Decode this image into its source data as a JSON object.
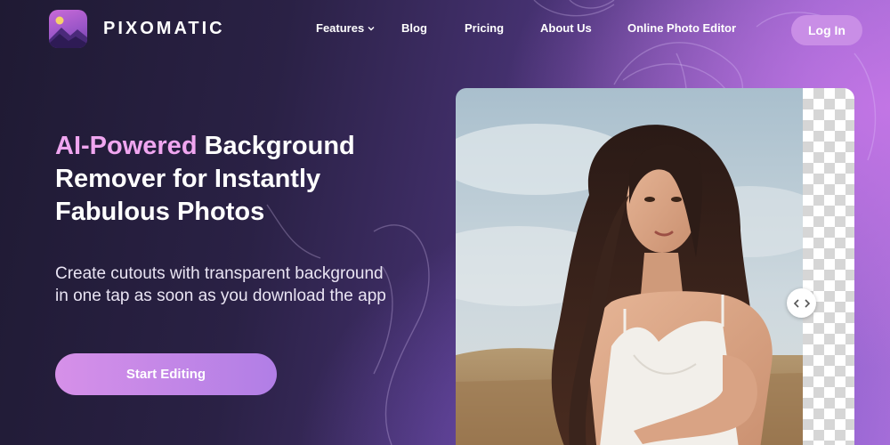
{
  "header": {
    "logo": {
      "text": "PIXOMATIC",
      "icon": "image-landscape-icon"
    },
    "nav": [
      {
        "label": "Features",
        "has_dropdown": true
      },
      {
        "label": "Blog"
      },
      {
        "label": "Pricing"
      },
      {
        "label": "About Us"
      },
      {
        "label": "Online Photo Editor"
      }
    ],
    "login_label": "Log In"
  },
  "hero": {
    "headline_accent": "AI-Powered",
    "headline_rest_line1": " Background",
    "headline_line2": "Remover for Instantly",
    "headline_line3": "Fabulous Photos",
    "subtext_line1": "Create cutouts with transparent background",
    "subtext_line2": "in one tap as soon as you download the app",
    "cta_label": "Start Editing"
  },
  "comparison": {
    "handle_icon": "chevron-left-right-icon",
    "transparent_pattern": "checkerboard"
  },
  "colors": {
    "accent_pink": "#f0a6f0",
    "button_purple": "#c98ee6",
    "background_dark": "#1f1a33",
    "background_light": "#a86fd8"
  }
}
